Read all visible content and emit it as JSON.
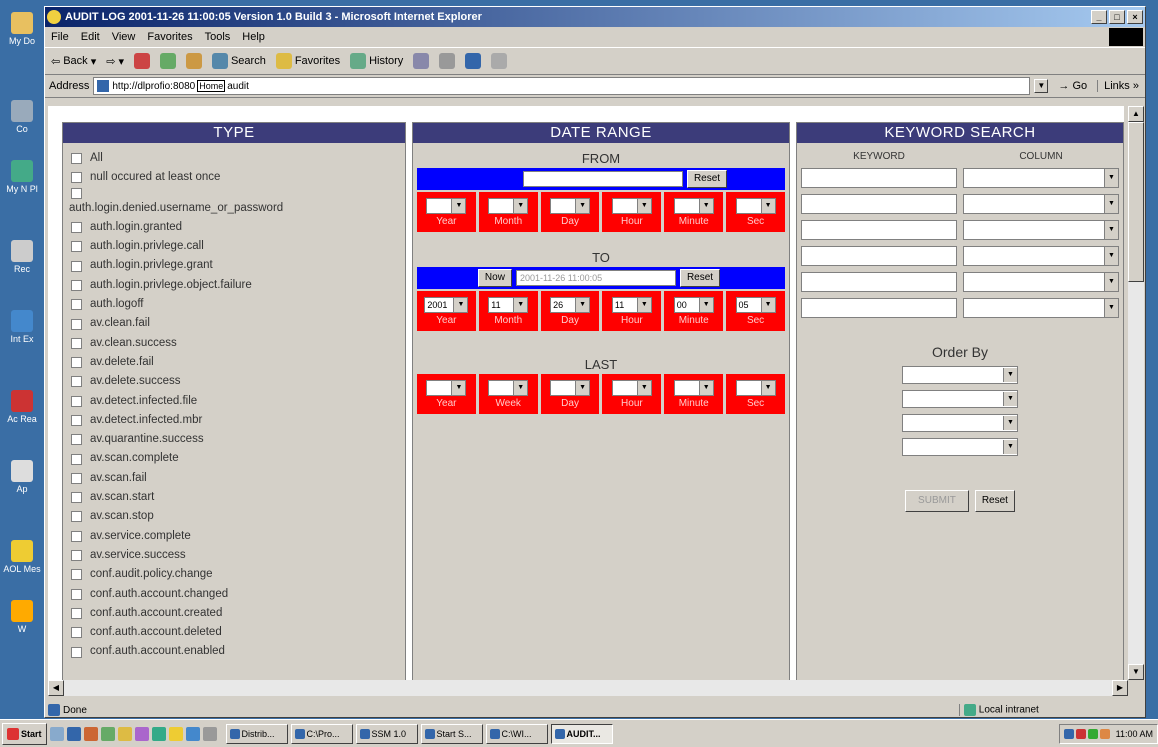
{
  "window": {
    "title": "AUDIT LOG 2001-11-26 11:00:05 Version 1.0 Build 3 - Microsoft Internet Explorer",
    "menu": [
      "File",
      "Edit",
      "View",
      "Favorites",
      "Tools",
      "Help"
    ],
    "toolbar": {
      "back": "Back",
      "search": "Search",
      "favorites": "Favorites",
      "history": "History"
    },
    "address_label": "Address",
    "address_prefix": "http://dlprofio:8080",
    "address_tooltip": "Home",
    "address_suffix": "audit",
    "go": "Go",
    "links": "Links"
  },
  "desktop_icons": [
    "My Do",
    "Co",
    "My N Pl",
    "Rec",
    "Int Ex",
    "Ac Rea",
    "Ap",
    "AOL Mes",
    "W"
  ],
  "type_panel": {
    "title": "TYPE",
    "items": [
      "All",
      "null occured at least once",
      "",
      "auth.login.denied.username_or_password",
      "auth.login.granted",
      "auth.login.privlege.call",
      "auth.login.privlege.grant",
      "auth.login.privlege.object.failure",
      "auth.logoff",
      "av.clean.fail",
      "av.clean.success",
      "av.delete.fail",
      "av.delete.success",
      "av.detect.infected.file",
      "av.detect.infected.mbr",
      "av.quarantine.success",
      "av.scan.complete",
      "av.scan.fail",
      "av.scan.start",
      "av.scan.stop",
      "av.service.complete",
      "av.service.success",
      "conf.audit.policy.change",
      "conf.auth.account.changed",
      "conf.auth.account.created",
      "conf.auth.account.deleted",
      "conf.auth.account.enabled"
    ]
  },
  "date_panel": {
    "title": "DATE RANGE",
    "from_label": "FROM",
    "to_label": "TO",
    "last_label": "LAST",
    "reset": "Reset",
    "now": "Now",
    "to_value": "2001-11-26 11:00:05",
    "from_units": [
      "Year",
      "Month",
      "Day",
      "Hour",
      "Minute",
      "Sec"
    ],
    "to_values": [
      "2001",
      "11",
      "26",
      "11",
      "00",
      "05"
    ],
    "last_units": [
      "Year",
      "Week",
      "Day",
      "Hour",
      "Minute",
      "Sec"
    ]
  },
  "keyword_panel": {
    "title": "KEYWORD SEARCH",
    "keyword_col": "KEYWORD",
    "column_col": "COLUMN",
    "order_by": "Order By",
    "submit": "SUBMIT",
    "reset": "Reset"
  },
  "status": {
    "left": "Done",
    "zone": "Local intranet"
  },
  "taskbar": {
    "start": "Start",
    "tasks": [
      "Distrib...",
      "C:\\Pro...",
      "SSM 1.0",
      "Start S...",
      "C:\\WI...",
      "AUDIT..."
    ],
    "clock": "11:00 AM"
  },
  "colors": {
    "panel_header": "#3c3c7a",
    "blue_bar": "#0000ff",
    "red_cells": "#ff0000",
    "desktop": "#3a6ea5"
  }
}
